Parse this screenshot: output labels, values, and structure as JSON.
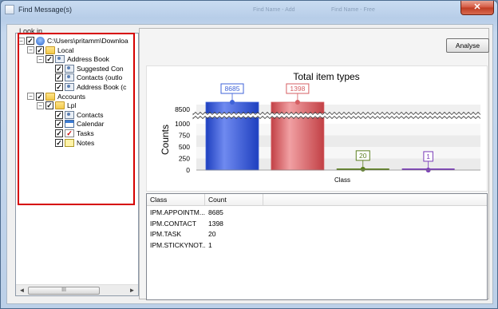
{
  "window": {
    "title": "Find Message(s)",
    "close_label": "✕",
    "ghost_tabs": [
      "Find Name - Add",
      "Find Name - Free"
    ]
  },
  "lookin": {
    "legend": "Look in",
    "tree": [
      {
        "label": "C:\\Users\\pritamm\\Downloa",
        "icon": "pc-icon",
        "checked": true,
        "expander": "−"
      },
      {
        "label": "Local",
        "icon": "folder-icon",
        "checked": true,
        "expander": "−"
      },
      {
        "label": "Address Book",
        "icon": "contact-icon",
        "checked": true,
        "expander": "−"
      },
      {
        "label": "Suggested Con",
        "icon": "contact-icon",
        "checked": true
      },
      {
        "label": "Contacts (outlo",
        "icon": "contact-icon",
        "checked": true
      },
      {
        "label": "Address Book (c",
        "icon": "contact-icon",
        "checked": true
      },
      {
        "label": "Accounts",
        "icon": "folder-icon",
        "checked": true,
        "expander": "−"
      },
      {
        "label": "Lpl",
        "icon": "folder-icon",
        "checked": true,
        "expander": "−"
      },
      {
        "label": "Contacts",
        "icon": "contact-icon",
        "checked": true
      },
      {
        "label": "Calendar",
        "icon": "calendar-icon",
        "checked": true
      },
      {
        "label": "Tasks",
        "icon": "tasks-icon",
        "checked": true
      },
      {
        "label": "Notes",
        "icon": "notes-icon",
        "checked": true
      }
    ],
    "scroll_left": "◄",
    "scroll_right": "►",
    "scroll_grip": "III"
  },
  "analyse_label": "Analyse",
  "chart_data": {
    "type": "bar",
    "title": "Total item types",
    "xlabel": "Class",
    "ylabel": "Counts",
    "categories": [
      "IPM.APPOINTMENT",
      "IPM.CONTACT",
      "IPM.TASK",
      "IPM.STICKYNOTE"
    ],
    "values": [
      8685,
      1398,
      20,
      1
    ],
    "data_labels": [
      "8685",
      "1398",
      "20",
      "1"
    ],
    "yticks": [
      "0",
      "250",
      "500",
      "750",
      "1000",
      "8500"
    ],
    "broken_axis": true,
    "colors": [
      "#3f63d8",
      "#d65f63",
      "#5b7f1f",
      "#7a3bb8"
    ],
    "grid": true
  },
  "grid": {
    "headers": [
      "Class",
      "Count"
    ],
    "rows": [
      [
        "IPM.APPOINTM...",
        "8685"
      ],
      [
        "IPM.CONTACT",
        "1398"
      ],
      [
        "IPM.TASK",
        "20"
      ],
      [
        "IPM.STICKYNOT...",
        "1"
      ]
    ]
  }
}
